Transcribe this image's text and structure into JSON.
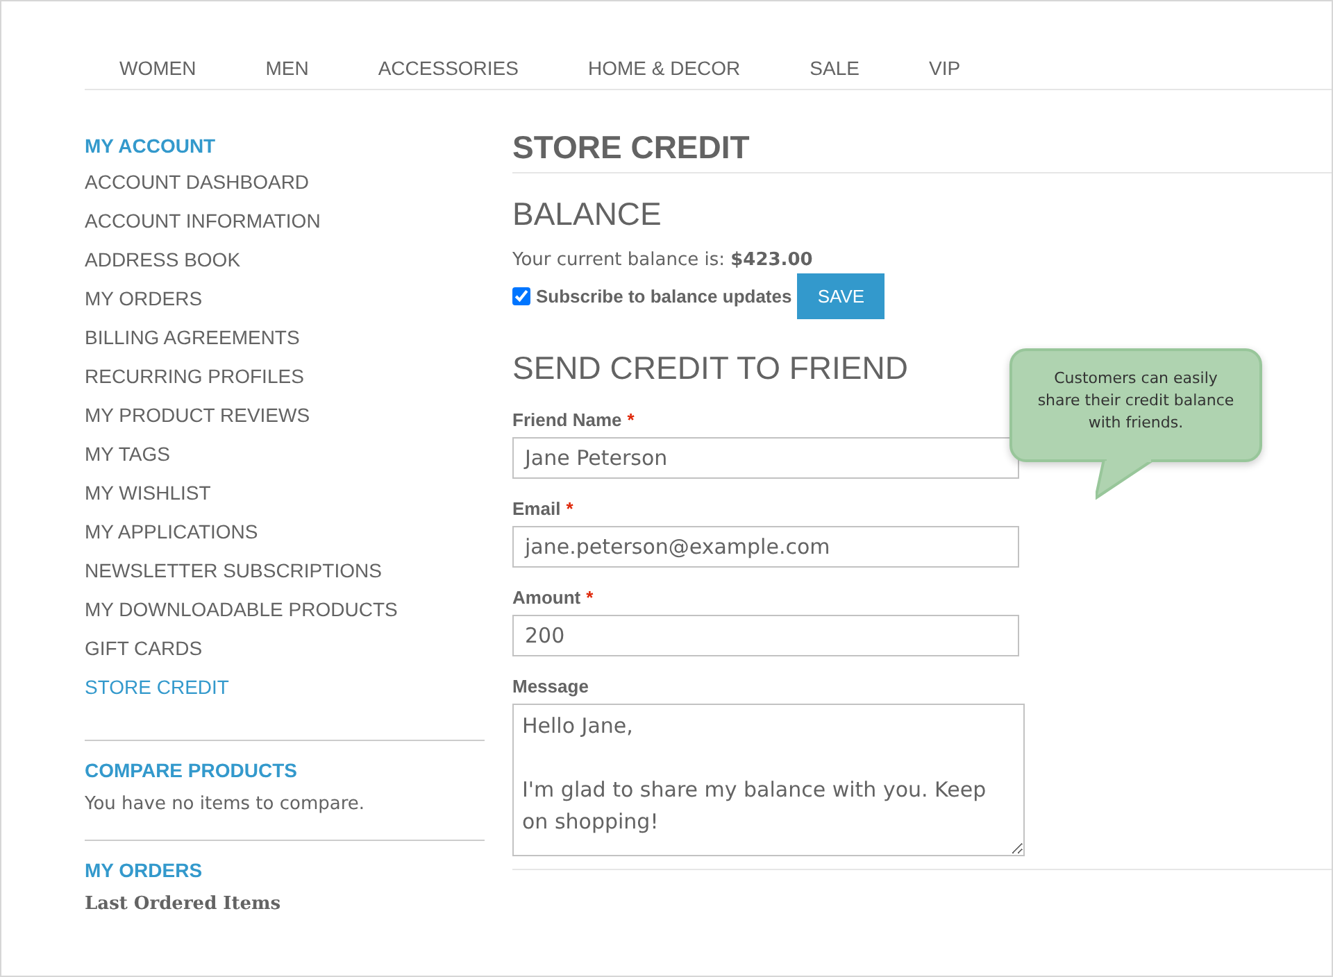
{
  "nav": [
    "WOMEN",
    "MEN",
    "ACCESSORIES",
    "HOME & DECOR",
    "SALE",
    "VIP"
  ],
  "sidebar": {
    "title": "MY ACCOUNT",
    "items": [
      {
        "label": "ACCOUNT DASHBOARD",
        "selected": false
      },
      {
        "label": "ACCOUNT INFORMATION",
        "selected": false
      },
      {
        "label": "ADDRESS BOOK",
        "selected": false
      },
      {
        "label": "MY ORDERS",
        "selected": false
      },
      {
        "label": "BILLING AGREEMENTS",
        "selected": false
      },
      {
        "label": "RECURRING PROFILES",
        "selected": false
      },
      {
        "label": "MY PRODUCT REVIEWS",
        "selected": false
      },
      {
        "label": "MY TAGS",
        "selected": false
      },
      {
        "label": "MY WISHLIST",
        "selected": false
      },
      {
        "label": "MY APPLICATIONS",
        "selected": false
      },
      {
        "label": "NEWSLETTER SUBSCRIPTIONS",
        "selected": false
      },
      {
        "label": "MY DOWNLOADABLE PRODUCTS",
        "selected": false
      },
      {
        "label": "GIFT CARDS",
        "selected": false
      },
      {
        "label": "STORE CREDIT",
        "selected": true
      }
    ],
    "compare": {
      "title": "COMPARE PRODUCTS",
      "text": "You have no items to compare."
    },
    "orders": {
      "title": "MY ORDERS",
      "text": "Last Ordered Items"
    }
  },
  "page_title": "STORE CREDIT",
  "balance": {
    "heading": "BALANCE",
    "text": "Your current balance is: **$423.00**",
    "subscribe": {
      "label": "Subscribe to balance updates",
      "checked": true
    },
    "save": "SAVE"
  },
  "send": {
    "heading": "SEND CREDIT TO FRIEND",
    "fields": [
      {
        "kind": "input",
        "label": "Friend Name",
        "required_mark": "*",
        "value": "Jane Peterson"
      },
      {
        "kind": "input",
        "label": "Email",
        "required_mark": "*",
        "value": "jane.peterson@example.com"
      },
      {
        "kind": "input",
        "label": "Amount",
        "required_mark": "*",
        "value": "200"
      },
      {
        "kind": "textarea",
        "label": "Message",
        "value": "Hello Jane,\n\nI'm glad to share my balance with you. Keep on shopping!"
      }
    ]
  },
  "callout": "Customers can easily share their credit balance with friends."
}
